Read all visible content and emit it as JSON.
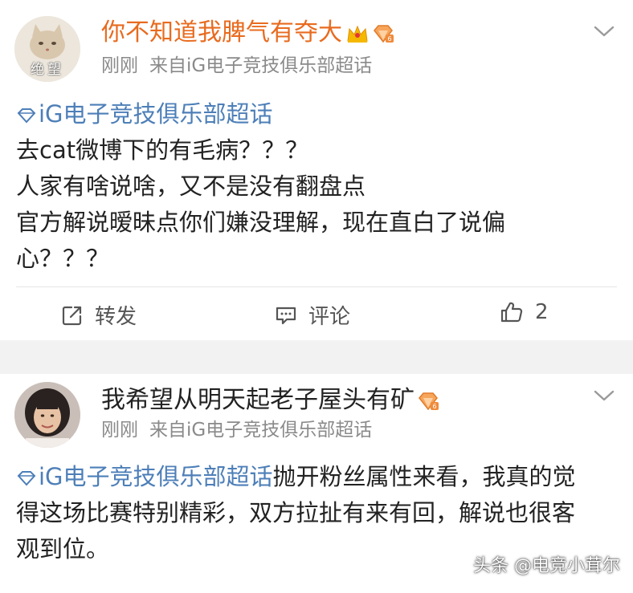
{
  "posts": [
    {
      "nickname": "你不知道我脾气有夺大",
      "avatar_text": "绝望",
      "time": "刚刚",
      "source_prefix": "来自",
      "source": "iG电子竞技俱乐部超话",
      "topic": "iG电子竞技俱乐部超话",
      "lines": [
        "去cat微博下的有毛病？？？",
        "人家有啥说啥，又不是没有翻盘点",
        "官方解说暧昧点你们嫌没理解，现在直白了说偏",
        "心？？？"
      ],
      "actions": {
        "repost": "转发",
        "comment": "评论",
        "like_count": "2"
      }
    },
    {
      "nickname": "我希望从明天起老子屋头有矿",
      "time": "刚刚",
      "source_prefix": "来自",
      "source": "iG电子竞技俱乐部超话",
      "topic": "iG电子竞技俱乐部超话",
      "first_line_rest": "抛开粉丝属性来看，我真的觉",
      "lines": [
        "得这场比赛特别精彩，双方拉扯有来有回，解说也很客",
        "观到位。"
      ]
    }
  ],
  "watermark": "头条 @电竞小茸尔",
  "colors": {
    "vip_name": "#e86b1f",
    "topic_link": "#4d7fb8",
    "meta_gray": "#8a8a8a",
    "separator": "#f2f2f2"
  },
  "icons": [
    "crown-icon",
    "diamond-badge-icon",
    "topic-diamond-icon",
    "chevron-down-icon",
    "repost-icon",
    "comment-icon",
    "like-icon"
  ]
}
